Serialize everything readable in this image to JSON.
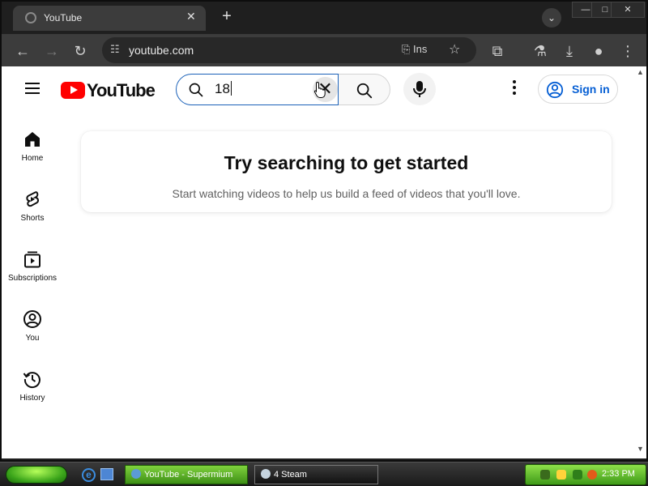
{
  "browser": {
    "tab_title": "YouTube",
    "url": "youtube.com",
    "install_label": "Ins",
    "icons": [
      "globe-icon",
      "close-icon",
      "plus-icon",
      "chevron-down-icon",
      "minimize-icon",
      "maximize-icon",
      "back-icon",
      "forward-icon",
      "reload-icon",
      "site-settings-icon",
      "install-icon",
      "star-icon",
      "extensions-icon",
      "labs-icon",
      "download-icon",
      "profile-icon",
      "more-icon"
    ]
  },
  "youtube": {
    "logo_text": "YouTube",
    "search": {
      "value": "18"
    },
    "signin_label": "Sign in",
    "guide": [
      {
        "label": "Home",
        "icon": "home-icon"
      },
      {
        "label": "Shorts",
        "icon": "shorts-icon"
      },
      {
        "label": "Subscriptions",
        "icon": "subscriptions-icon"
      },
      {
        "label": "You",
        "icon": "you-icon"
      },
      {
        "label": "History",
        "icon": "history-icon"
      }
    ],
    "prompt": {
      "title": "Try searching to get started",
      "subtitle": "Start watching videos to help us build a feed of videos that you'll love."
    }
  },
  "taskbar": {
    "tasks": [
      {
        "label": "YouTube - Supermium"
      },
      {
        "label": "4 Steam"
      }
    ],
    "clock": "2:33 PM"
  },
  "colors": {
    "youtube_red": "#ff0000",
    "link_blue": "#065fd4",
    "focus_blue": "#1c62b9",
    "xp_green": "#3d8f16"
  }
}
